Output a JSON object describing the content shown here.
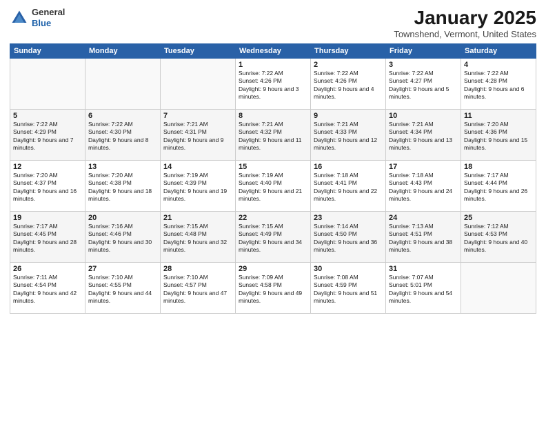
{
  "header": {
    "logo_general": "General",
    "logo_blue": "Blue",
    "month_title": "January 2025",
    "location": "Townshend, Vermont, United States"
  },
  "days_of_week": [
    "Sunday",
    "Monday",
    "Tuesday",
    "Wednesday",
    "Thursday",
    "Friday",
    "Saturday"
  ],
  "weeks": [
    [
      {
        "day": "",
        "info": ""
      },
      {
        "day": "",
        "info": ""
      },
      {
        "day": "",
        "info": ""
      },
      {
        "day": "1",
        "info": "Sunrise: 7:22 AM\nSunset: 4:26 PM\nDaylight: 9 hours and 3 minutes."
      },
      {
        "day": "2",
        "info": "Sunrise: 7:22 AM\nSunset: 4:26 PM\nDaylight: 9 hours and 4 minutes."
      },
      {
        "day": "3",
        "info": "Sunrise: 7:22 AM\nSunset: 4:27 PM\nDaylight: 9 hours and 5 minutes."
      },
      {
        "day": "4",
        "info": "Sunrise: 7:22 AM\nSunset: 4:28 PM\nDaylight: 9 hours and 6 minutes."
      }
    ],
    [
      {
        "day": "5",
        "info": "Sunrise: 7:22 AM\nSunset: 4:29 PM\nDaylight: 9 hours and 7 minutes."
      },
      {
        "day": "6",
        "info": "Sunrise: 7:22 AM\nSunset: 4:30 PM\nDaylight: 9 hours and 8 minutes."
      },
      {
        "day": "7",
        "info": "Sunrise: 7:21 AM\nSunset: 4:31 PM\nDaylight: 9 hours and 9 minutes."
      },
      {
        "day": "8",
        "info": "Sunrise: 7:21 AM\nSunset: 4:32 PM\nDaylight: 9 hours and 11 minutes."
      },
      {
        "day": "9",
        "info": "Sunrise: 7:21 AM\nSunset: 4:33 PM\nDaylight: 9 hours and 12 minutes."
      },
      {
        "day": "10",
        "info": "Sunrise: 7:21 AM\nSunset: 4:34 PM\nDaylight: 9 hours and 13 minutes."
      },
      {
        "day": "11",
        "info": "Sunrise: 7:20 AM\nSunset: 4:36 PM\nDaylight: 9 hours and 15 minutes."
      }
    ],
    [
      {
        "day": "12",
        "info": "Sunrise: 7:20 AM\nSunset: 4:37 PM\nDaylight: 9 hours and 16 minutes."
      },
      {
        "day": "13",
        "info": "Sunrise: 7:20 AM\nSunset: 4:38 PM\nDaylight: 9 hours and 18 minutes."
      },
      {
        "day": "14",
        "info": "Sunrise: 7:19 AM\nSunset: 4:39 PM\nDaylight: 9 hours and 19 minutes."
      },
      {
        "day": "15",
        "info": "Sunrise: 7:19 AM\nSunset: 4:40 PM\nDaylight: 9 hours and 21 minutes."
      },
      {
        "day": "16",
        "info": "Sunrise: 7:18 AM\nSunset: 4:41 PM\nDaylight: 9 hours and 22 minutes."
      },
      {
        "day": "17",
        "info": "Sunrise: 7:18 AM\nSunset: 4:43 PM\nDaylight: 9 hours and 24 minutes."
      },
      {
        "day": "18",
        "info": "Sunrise: 7:17 AM\nSunset: 4:44 PM\nDaylight: 9 hours and 26 minutes."
      }
    ],
    [
      {
        "day": "19",
        "info": "Sunrise: 7:17 AM\nSunset: 4:45 PM\nDaylight: 9 hours and 28 minutes."
      },
      {
        "day": "20",
        "info": "Sunrise: 7:16 AM\nSunset: 4:46 PM\nDaylight: 9 hours and 30 minutes."
      },
      {
        "day": "21",
        "info": "Sunrise: 7:15 AM\nSunset: 4:48 PM\nDaylight: 9 hours and 32 minutes."
      },
      {
        "day": "22",
        "info": "Sunrise: 7:15 AM\nSunset: 4:49 PM\nDaylight: 9 hours and 34 minutes."
      },
      {
        "day": "23",
        "info": "Sunrise: 7:14 AM\nSunset: 4:50 PM\nDaylight: 9 hours and 36 minutes."
      },
      {
        "day": "24",
        "info": "Sunrise: 7:13 AM\nSunset: 4:51 PM\nDaylight: 9 hours and 38 minutes."
      },
      {
        "day": "25",
        "info": "Sunrise: 7:12 AM\nSunset: 4:53 PM\nDaylight: 9 hours and 40 minutes."
      }
    ],
    [
      {
        "day": "26",
        "info": "Sunrise: 7:11 AM\nSunset: 4:54 PM\nDaylight: 9 hours and 42 minutes."
      },
      {
        "day": "27",
        "info": "Sunrise: 7:10 AM\nSunset: 4:55 PM\nDaylight: 9 hours and 44 minutes."
      },
      {
        "day": "28",
        "info": "Sunrise: 7:10 AM\nSunset: 4:57 PM\nDaylight: 9 hours and 47 minutes."
      },
      {
        "day": "29",
        "info": "Sunrise: 7:09 AM\nSunset: 4:58 PM\nDaylight: 9 hours and 49 minutes."
      },
      {
        "day": "30",
        "info": "Sunrise: 7:08 AM\nSunset: 4:59 PM\nDaylight: 9 hours and 51 minutes."
      },
      {
        "day": "31",
        "info": "Sunrise: 7:07 AM\nSunset: 5:01 PM\nDaylight: 9 hours and 54 minutes."
      },
      {
        "day": "",
        "info": ""
      }
    ]
  ]
}
